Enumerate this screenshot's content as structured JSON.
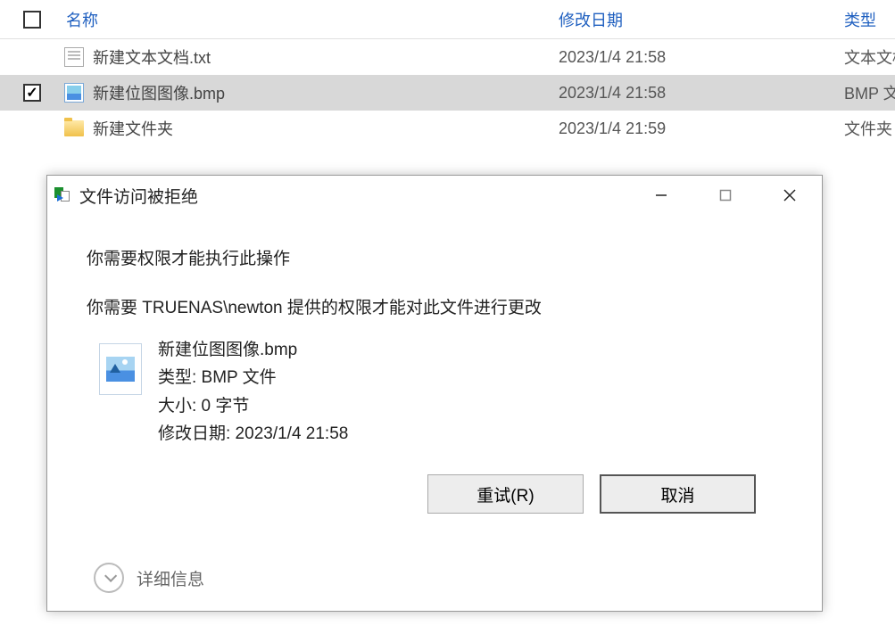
{
  "header": {
    "name": "名称",
    "date": "修改日期",
    "type": "类型"
  },
  "files": [
    {
      "name": "新建文本文档.txt",
      "date": "2023/1/4 21:58",
      "type": "文本文档",
      "icon": "txt",
      "selected": false
    },
    {
      "name": "新建位图图像.bmp",
      "date": "2023/1/4 21:58",
      "type": "BMP 文件",
      "icon": "bmp",
      "selected": true
    },
    {
      "name": "新建文件夹",
      "date": "2023/1/4 21:59",
      "type": "文件夹",
      "icon": "folder",
      "selected": false
    }
  ],
  "dialog": {
    "title": "文件访问被拒绝",
    "msg1": "你需要权限才能执行此操作",
    "msg2": "你需要 TRUENAS\\newton 提供的权限才能对此文件进行更改",
    "file_name": "新建位图图像.bmp",
    "file_type": "类型: BMP 文件",
    "file_size": "大小: 0 字节",
    "file_mtime": "修改日期: 2023/1/4 21:58",
    "retry_label": "重试(R)",
    "cancel_label": "取消",
    "details_label": "详细信息"
  }
}
